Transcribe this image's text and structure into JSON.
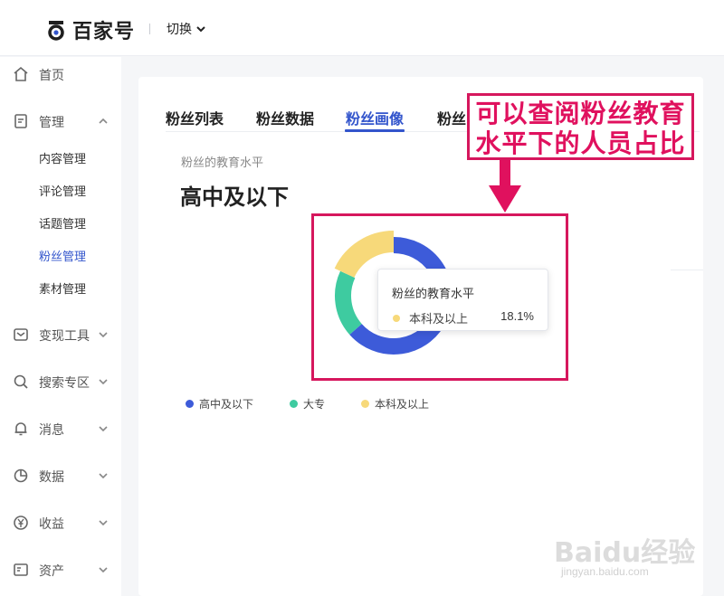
{
  "header": {
    "logo_text": "百家号",
    "switch_label": "切换"
  },
  "sidebar": {
    "items": [
      {
        "label": "首页",
        "icon": "home-icon"
      },
      {
        "label": "管理",
        "icon": "document-icon",
        "expanded": true
      },
      {
        "label": "变现工具",
        "icon": "wallet-icon"
      },
      {
        "label": "搜索专区",
        "icon": "search-icon"
      },
      {
        "label": "消息",
        "icon": "bell-icon"
      },
      {
        "label": "数据",
        "icon": "pie-chart-icon"
      },
      {
        "label": "收益",
        "icon": "yuan-icon"
      },
      {
        "label": "资产",
        "icon": "asset-icon"
      }
    ],
    "sub_items": [
      {
        "label": "内容管理"
      },
      {
        "label": "评论管理"
      },
      {
        "label": "话题管理"
      },
      {
        "label": "粉丝管理",
        "active": true
      },
      {
        "label": "素材管理"
      }
    ]
  },
  "main": {
    "tabs": [
      {
        "label": "粉丝列表"
      },
      {
        "label": "粉丝数据"
      },
      {
        "label": "粉丝画像",
        "active": true
      },
      {
        "label": "粉丝"
      }
    ],
    "section_label": "粉丝的教育水平",
    "section_value": "高中及以下"
  },
  "tooltip": {
    "title": "粉丝的教育水平",
    "name": "本科及以上",
    "value": "18.1%"
  },
  "annotation": {
    "line1": "可以查阅粉丝教育",
    "line2": "水平下的人员占比"
  },
  "watermark": {
    "big": "Baidu经验",
    "small": "jingyan.baidu.com"
  },
  "colors": {
    "accent": "#3355cc",
    "annotation": "#d6175d"
  },
  "chart_data": {
    "type": "pie",
    "donut": true,
    "categories": [
      "高中及以下",
      "大专",
      "本科及以上"
    ],
    "values": [
      63.5,
      18.4,
      18.1
    ],
    "colors": [
      "#3d5bd9",
      "#3ecba0",
      "#f7d97a"
    ],
    "highlighted": "本科及以上"
  }
}
